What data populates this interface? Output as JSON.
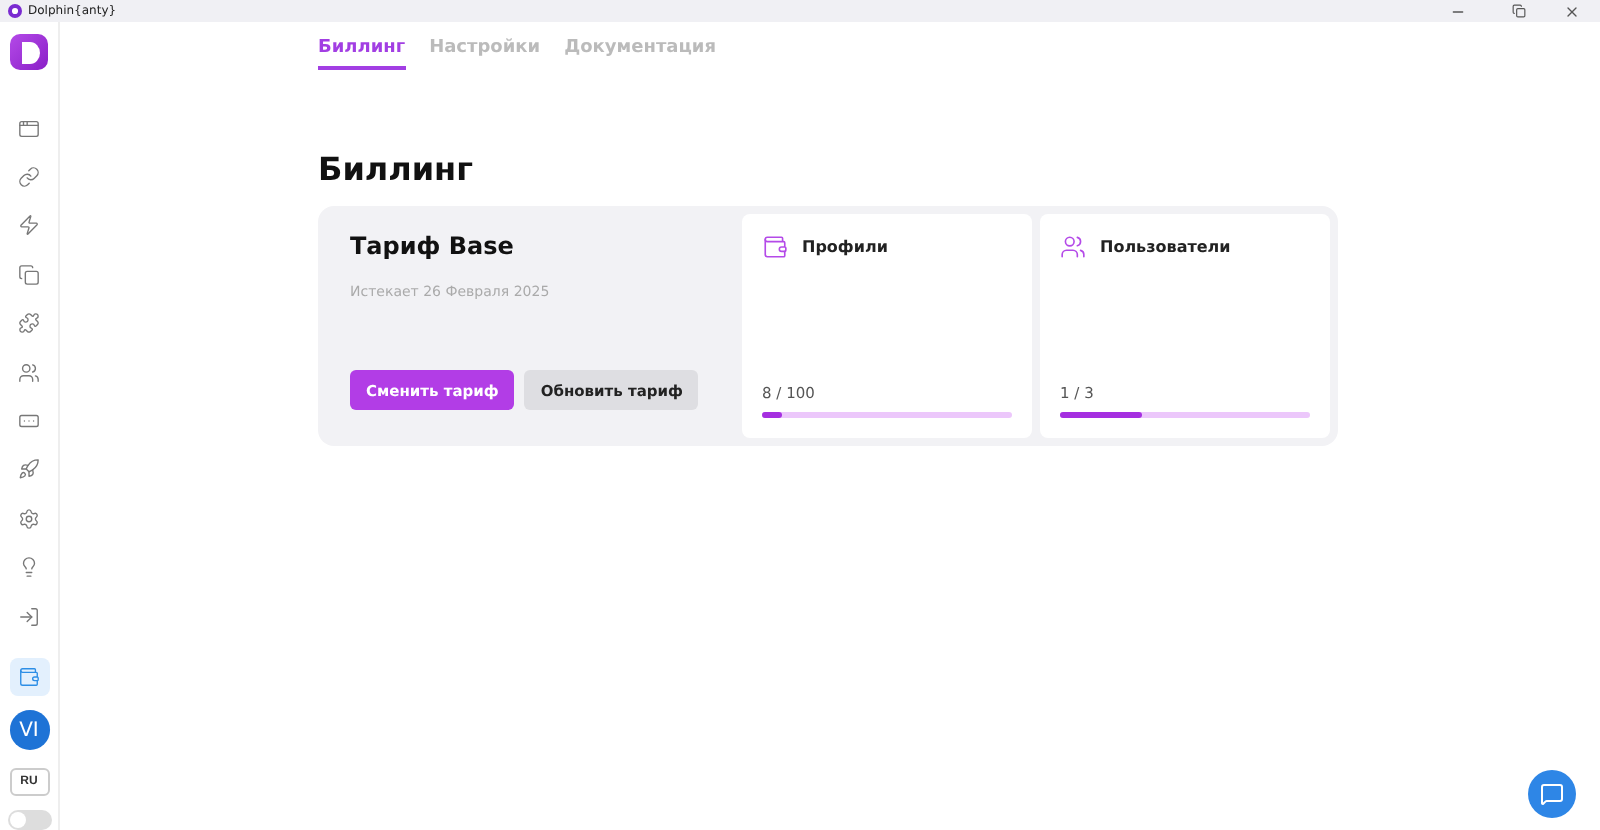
{
  "window": {
    "title": "Dolphin{anty}"
  },
  "sidebar": {
    "items": [
      {
        "selected": false
      },
      {
        "selected": false
      },
      {
        "selected": false
      },
      {
        "selected": false
      },
      {
        "selected": false
      },
      {
        "selected": false
      },
      {
        "selected": false
      },
      {
        "selected": false
      },
      {
        "selected": false
      },
      {
        "selected": false
      },
      {
        "selected": false
      },
      {
        "selected": true
      }
    ],
    "avatar": "VI",
    "language": "RU",
    "theme_toggle": {
      "on": false
    }
  },
  "tabs": [
    {
      "label": "Биллинг",
      "selected": true
    },
    {
      "label": "Настройки",
      "selected": false
    },
    {
      "label": "Документация",
      "selected": false
    }
  ],
  "page_title": "Биллинг",
  "plan": {
    "name": "Тариф Base",
    "expires": "Истекает 26 Февраля 2025",
    "buttons": [
      {
        "label": "Сменить тариф",
        "kind": "primary"
      },
      {
        "label": "Обновить тариф",
        "kind": "secondary"
      }
    ]
  },
  "limits": [
    {
      "title": "Профили",
      "reading": "8 / 100",
      "level": 0.08
    },
    {
      "title": "Пользователи",
      "reading": "1 / 3",
      "level": 0.33
    }
  ]
}
